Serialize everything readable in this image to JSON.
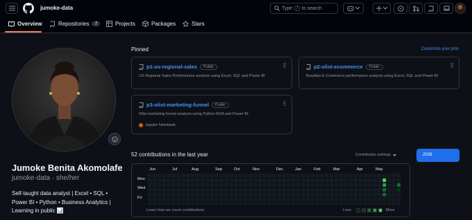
{
  "header": {
    "username": "jumoke-data",
    "search_placeholder_prefix": "Type",
    "search_key": "/",
    "search_placeholder_suffix": "to search"
  },
  "tabs": [
    {
      "label": "Overview"
    },
    {
      "label": "Repositories",
      "count": "7"
    },
    {
      "label": "Projects"
    },
    {
      "label": "Packages"
    },
    {
      "label": "Stars"
    }
  ],
  "profile": {
    "name": "Jumoke Benita Akomolafe",
    "login": "jumoke-data",
    "pronouns": "she/her",
    "bio_lines": [
      "Self-taught data analyst | Excel • SQL •",
      "Power BI • Python • Business Analytics |",
      "Learning in public 📊"
    ]
  },
  "pinned": {
    "heading": "Pinned",
    "customize": "Customize your pins",
    "repos": [
      {
        "name": "p1-us-regional-sales",
        "visibility": "Public",
        "description": "US Regional Sales Performance analysis using Excel, SQL and Power BI"
      },
      {
        "name": "p2-olist-ecommerce",
        "visibility": "Public",
        "description": "Brazilian E-Commerce performance analysis using Excel, SQL and Power BI"
      },
      {
        "name": "p3-olist-marketing-funnel",
        "visibility": "Public",
        "description": "Olist marketing funnel analysis using Python EDA and Power BI",
        "language": "Jupyter Notebook",
        "language_color": "#da5b0b"
      }
    ]
  },
  "contributions": {
    "heading": "52 contributions in the last year",
    "settings": "Contribution settings",
    "year": "2026",
    "months": [
      "Jun",
      "Jul",
      "Aug",
      "Sep",
      "Oct",
      "Nov",
      "Dec",
      "Jan",
      "Feb",
      "Mar",
      "Apr",
      "May"
    ],
    "days": [
      "Mon",
      "Wed",
      "Fri"
    ],
    "learn_link": "Learn how we count contributions",
    "less": "Less",
    "more": "More",
    "colors": {
      "empty": "#151b23",
      "level1": "#033a16",
      "level2": "#196c2e",
      "level3": "#2ea043",
      "level4": "#56d364"
    }
  }
}
